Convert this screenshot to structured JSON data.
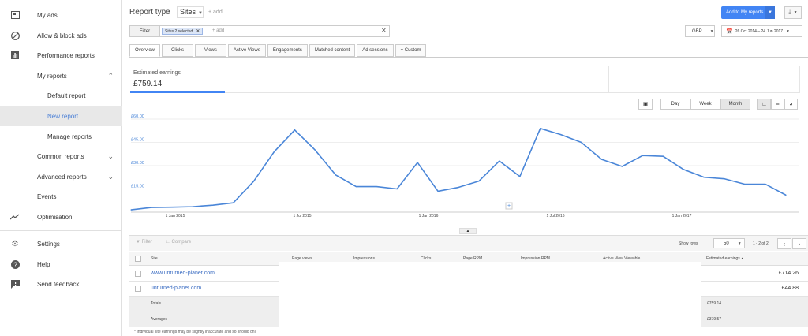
{
  "sidebar": {
    "items": [
      {
        "label": "My ads",
        "icon": "ads-icon"
      },
      {
        "label": "Allow & block ads",
        "icon": "block-icon"
      },
      {
        "label": "Performance reports",
        "icon": "bar-chart-icon"
      },
      {
        "label": "My reports"
      },
      {
        "label": "Default report"
      },
      {
        "label": "New report"
      },
      {
        "label": "Manage reports"
      },
      {
        "label": "Common reports"
      },
      {
        "label": "Advanced reports"
      },
      {
        "label": "Events"
      },
      {
        "label": "Optimisation",
        "icon": "trending-icon"
      },
      {
        "label": "Settings",
        "icon": "gear-icon"
      },
      {
        "label": "Help",
        "icon": "help-icon"
      },
      {
        "label": "Send feedback",
        "icon": "feedback-icon"
      }
    ]
  },
  "header": {
    "report_type": "Report type",
    "sites_value": "Sites",
    "add_label": "+ add",
    "add_to_reports": "Add to My reports"
  },
  "filter": {
    "button": "Filter",
    "chip": "Sites 2 selected",
    "add": "+ add",
    "currency": "GBP",
    "date_range": "26 Oct 2014 – 24 Jun 2017"
  },
  "tabs": [
    "Overview",
    "Clicks",
    "Views",
    "Active Views",
    "Engagements",
    "Matched content",
    "Ad sessions",
    "+ Custom"
  ],
  "metric": {
    "title": "Estimated earnings",
    "value": "£759.14"
  },
  "granularity": [
    "Day",
    "Week",
    "Month"
  ],
  "chart_data": {
    "type": "line",
    "title": "",
    "ylabel": "",
    "xlabel": "",
    "y_ticks": [
      "£60.00",
      "£45.00",
      "£30.00",
      "£15.00"
    ],
    "x_ticks": [
      "1 Jan 2015",
      "1 Jul 2015",
      "1 Jan 2016",
      "1 Jul 2016",
      "1 Jan 2017"
    ],
    "ylim": [
      0,
      60
    ],
    "series": [
      {
        "values": [
          1.5,
          3,
          3.2,
          3.5,
          4.5,
          6,
          20,
          39,
          53,
          40,
          24,
          16.5,
          16.5,
          15,
          32,
          13.5,
          16,
          20,
          33,
          23,
          54,
          50,
          45,
          34,
          29.5,
          36.5,
          36,
          27.5,
          22.5,
          21.5,
          18,
          18,
          11
        ]
      }
    ],
    "color": "#4a86d8"
  },
  "table_toolbar": {
    "filter": "Filter",
    "compare": "Compare",
    "show_rows": "Show rows",
    "rows_value": "50",
    "pager": "1 - 2 of 2"
  },
  "table": {
    "headers": [
      "Site",
      "Page views",
      "Impressions",
      "Clicks",
      "Page RPM",
      "Impression RPM",
      "Active View Viewable",
      "Estimated earnings ▴"
    ],
    "rows": [
      {
        "site": "www.unturned-planet.com",
        "earnings": "£714.26"
      },
      {
        "site": "unturned-planet.com",
        "earnings": "£44.88"
      }
    ],
    "totals_label": "Totals",
    "totals_value": "£759.14",
    "averages_label": "Averages",
    "averages_value": "£379.57"
  },
  "footnote": "* Individual site earnings may be slightly inaccurate and so should onl"
}
